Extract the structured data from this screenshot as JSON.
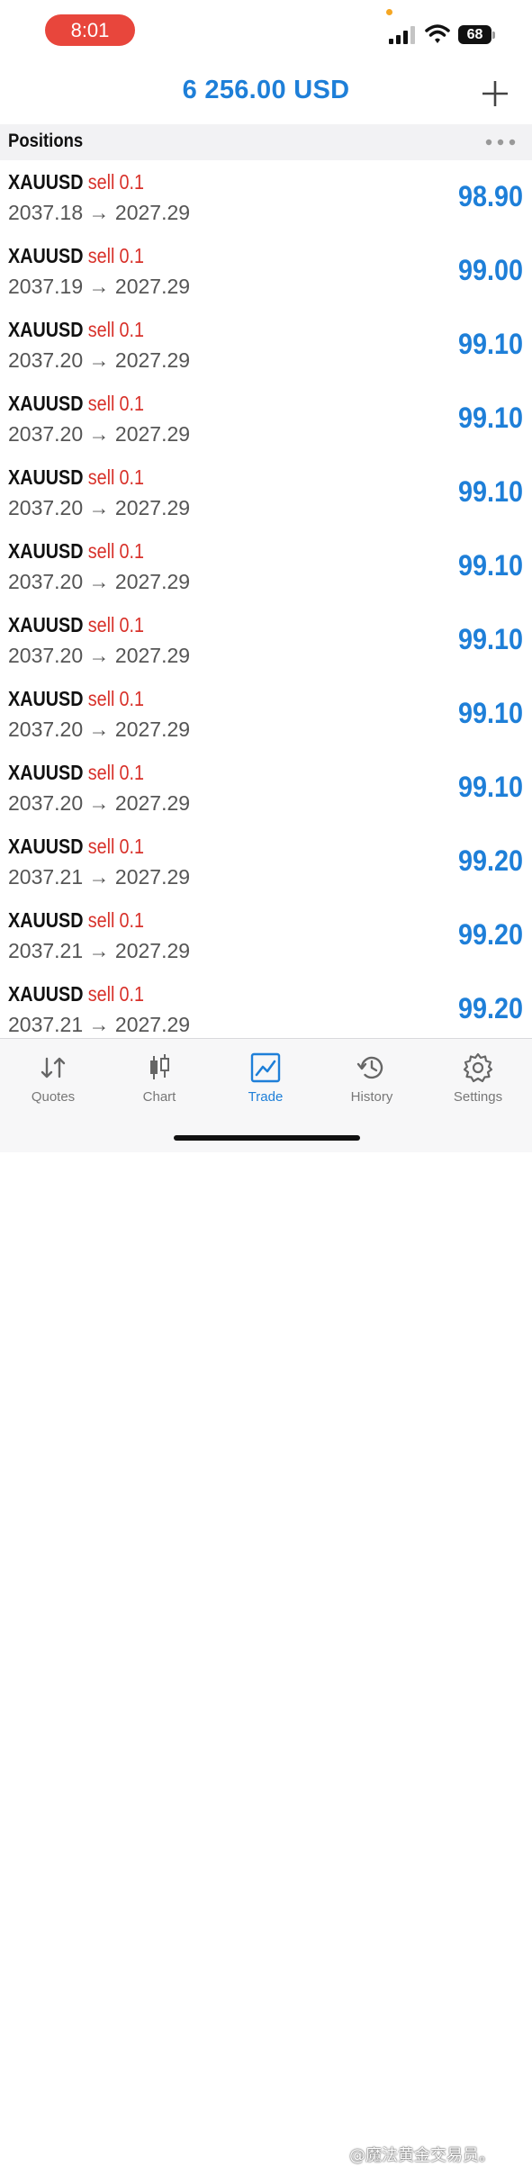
{
  "status_bar": {
    "time": "8:01",
    "battery": "68",
    "icons": [
      "signal-icon",
      "wifi-icon",
      "battery-icon"
    ],
    "time_pill_color": "#e8463c"
  },
  "header": {
    "balance": "6 256.00 USD",
    "add_icon": "plus-icon"
  },
  "section": {
    "title": "Positions",
    "more_icon": "more-icon"
  },
  "positions": [
    {
      "symbol": "XAUUSD",
      "side": "sell",
      "volume": "0.1",
      "prices": "2037.18 → 2027.29",
      "profit": "98.90"
    },
    {
      "symbol": "XAUUSD",
      "side": "sell",
      "volume": "0.1",
      "prices": "2037.19 → 2027.29",
      "profit": "99.00"
    },
    {
      "symbol": "XAUUSD",
      "side": "sell",
      "volume": "0.1",
      "prices": "2037.20 → 2027.29",
      "profit": "99.10"
    },
    {
      "symbol": "XAUUSD",
      "side": "sell",
      "volume": "0.1",
      "prices": "2037.20 → 2027.29",
      "profit": "99.10"
    },
    {
      "symbol": "XAUUSD",
      "side": "sell",
      "volume": "0.1",
      "prices": "2037.20 → 2027.29",
      "profit": "99.10"
    },
    {
      "symbol": "XAUUSD",
      "side": "sell",
      "volume": "0.1",
      "prices": "2037.20 → 2027.29",
      "profit": "99.10"
    },
    {
      "symbol": "XAUUSD",
      "side": "sell",
      "volume": "0.1",
      "prices": "2037.20 → 2027.29",
      "profit": "99.10"
    },
    {
      "symbol": "XAUUSD",
      "side": "sell",
      "volume": "0.1",
      "prices": "2037.20 → 2027.29",
      "profit": "99.10"
    },
    {
      "symbol": "XAUUSD",
      "side": "sell",
      "volume": "0.1",
      "prices": "2037.20 → 2027.29",
      "profit": "99.10"
    },
    {
      "symbol": "XAUUSD",
      "side": "sell",
      "volume": "0.1",
      "prices": "2037.21 → 2027.29",
      "profit": "99.20"
    },
    {
      "symbol": "XAUUSD",
      "side": "sell",
      "volume": "0.1",
      "prices": "2037.21 → 2027.29",
      "profit": "99.20"
    },
    {
      "symbol": "XAUUSD",
      "side": "sell",
      "volume": "0.1",
      "prices": "2037.21 → 2027.29",
      "profit": "99.20"
    }
  ],
  "tabs": [
    {
      "label": "Quotes",
      "icon": "quotes-icon",
      "active": false
    },
    {
      "label": "Chart",
      "icon": "chart-icon",
      "active": false
    },
    {
      "label": "Trade",
      "icon": "trade-icon",
      "active": true
    },
    {
      "label": "History",
      "icon": "history-icon",
      "active": false
    },
    {
      "label": "Settings",
      "icon": "settings-icon",
      "active": false
    }
  ],
  "watermark": "@魔法黄金交易员。",
  "colors": {
    "accent": "#1e7fd8",
    "sell": "#d8312a",
    "tab_inactive": "#777777"
  }
}
